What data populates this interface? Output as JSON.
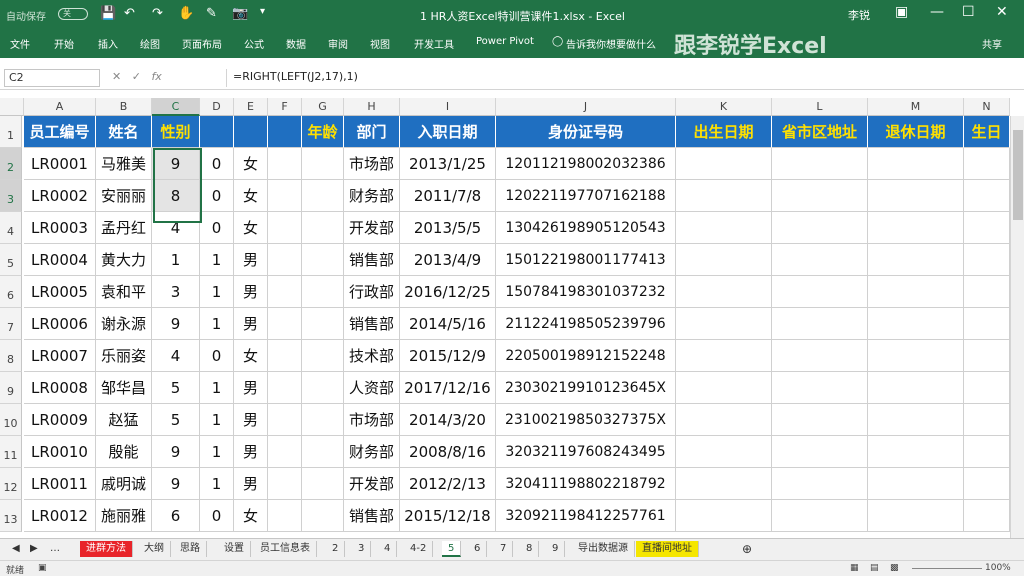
{
  "titlebar": {
    "autosave_label": "自动保存",
    "autosave_state": "关",
    "document_title": "1 HR人资Excel特训营课件1.xlsx  -  Excel",
    "user_name": "李锐"
  },
  "ribbon": {
    "tabs": [
      "文件",
      "开始",
      "插入",
      "绘图",
      "页面布局",
      "公式",
      "数据",
      "审阅",
      "视图",
      "开发工具",
      "Power Pivot",
      "告诉我你想要做什么"
    ],
    "brand_text": "跟李锐学Excel",
    "share_label": "共享"
  },
  "formula_bar": {
    "name_box": "C2",
    "formula": "=RIGHT(LEFT(J2,17),1)",
    "fx_label": "fx"
  },
  "columns": [
    "A",
    "B",
    "C",
    "D",
    "E",
    "F",
    "G",
    "H",
    "I",
    "J",
    "K",
    "L",
    "M",
    "N"
  ],
  "header_row": [
    "员工编号",
    "姓名",
    "性别",
    "",
    "",
    "",
    "年龄",
    "部门",
    "入职日期",
    "身份证号码",
    "出生日期",
    "省市区地址",
    "退休日期",
    "生日"
  ],
  "rows": [
    {
      "num": "1"
    },
    {
      "num": "2",
      "cells": [
        "LR0001",
        "马雅美",
        "9",
        "0",
        "女",
        "",
        "",
        "市场部",
        "2013/1/25",
        "120112198002032386",
        "",
        "",
        "",
        ""
      ]
    },
    {
      "num": "3",
      "cells": [
        "LR0002",
        "安丽丽",
        "8",
        "0",
        "女",
        "",
        "",
        "财务部",
        "2011/7/8",
        "120221197707162188",
        "",
        "",
        "",
        ""
      ]
    },
    {
      "num": "4",
      "cells": [
        "LR0003",
        "孟丹红",
        "4",
        "0",
        "女",
        "",
        "",
        "开发部",
        "2013/5/5",
        "130426198905120543",
        "",
        "",
        "",
        ""
      ]
    },
    {
      "num": "5",
      "cells": [
        "LR0004",
        "黄大力",
        "1",
        "1",
        "男",
        "",
        "",
        "销售部",
        "2013/4/9",
        "150122198001177413",
        "",
        "",
        "",
        ""
      ]
    },
    {
      "num": "6",
      "cells": [
        "LR0005",
        "袁和平",
        "3",
        "1",
        "男",
        "",
        "",
        "行政部",
        "2016/12/25",
        "150784198301037232",
        "",
        "",
        "",
        ""
      ]
    },
    {
      "num": "7",
      "cells": [
        "LR0006",
        "谢永源",
        "9",
        "1",
        "男",
        "",
        "",
        "销售部",
        "2014/5/16",
        "211224198505239796",
        "",
        "",
        "",
        ""
      ]
    },
    {
      "num": "8",
      "cells": [
        "LR0007",
        "乐丽姿",
        "4",
        "0",
        "女",
        "",
        "",
        "技术部",
        "2015/12/9",
        "220500198912152248",
        "",
        "",
        "",
        ""
      ]
    },
    {
      "num": "9",
      "cells": [
        "LR0008",
        "邹华昌",
        "5",
        "1",
        "男",
        "",
        "",
        "人资部",
        "2017/12/16",
        "230302199101236​45X",
        "",
        "",
        "",
        ""
      ]
    },
    {
      "num": "10",
      "cells": [
        "LR0009",
        "赵猛",
        "5",
        "1",
        "男",
        "",
        "",
        "市场部",
        "2014/3/20",
        "231002198503273​75X",
        "",
        "",
        "",
        ""
      ]
    },
    {
      "num": "11",
      "cells": [
        "LR0010",
        "殷能",
        "9",
        "1",
        "男",
        "",
        "",
        "财务部",
        "2008/8/16",
        "320321197608243495",
        "",
        "",
        "",
        ""
      ]
    },
    {
      "num": "12",
      "cells": [
        "LR0011",
        "戚明诚",
        "9",
        "1",
        "男",
        "",
        "",
        "开发部",
        "2012/2/13",
        "320411198802218792",
        "",
        "",
        "",
        ""
      ]
    },
    {
      "num": "13",
      "cells": [
        "LR0012",
        "施丽雅",
        "6",
        "0",
        "女",
        "",
        "",
        "销售部",
        "2015/12/18",
        "320921198412257761",
        "",
        "",
        "",
        ""
      ]
    }
  ],
  "sheet_tabs": [
    {
      "label": "进群方法",
      "style": "red"
    },
    {
      "label": "大纲",
      "style": ""
    },
    {
      "label": "思路",
      "style": ""
    },
    {
      "label": "设置",
      "style": ""
    },
    {
      "label": "员工信息表",
      "style": ""
    },
    {
      "label": "2",
      "style": ""
    },
    {
      "label": "3",
      "style": ""
    },
    {
      "label": "4",
      "style": ""
    },
    {
      "label": "4-2",
      "style": ""
    },
    {
      "label": "5",
      "style": "active"
    },
    {
      "label": "6",
      "style": ""
    },
    {
      "label": "7",
      "style": ""
    },
    {
      "label": "8",
      "style": ""
    },
    {
      "label": "9",
      "style": ""
    },
    {
      "label": "导出数据源",
      "style": ""
    },
    {
      "label": "直播间地址",
      "style": "yel"
    }
  ],
  "status": {
    "ready": "就绪",
    "zoom": "100%"
  },
  "colors": {
    "excel_green": "#217346",
    "header_blue": "#1f6fc1",
    "header_yellow": "#ffe000"
  }
}
